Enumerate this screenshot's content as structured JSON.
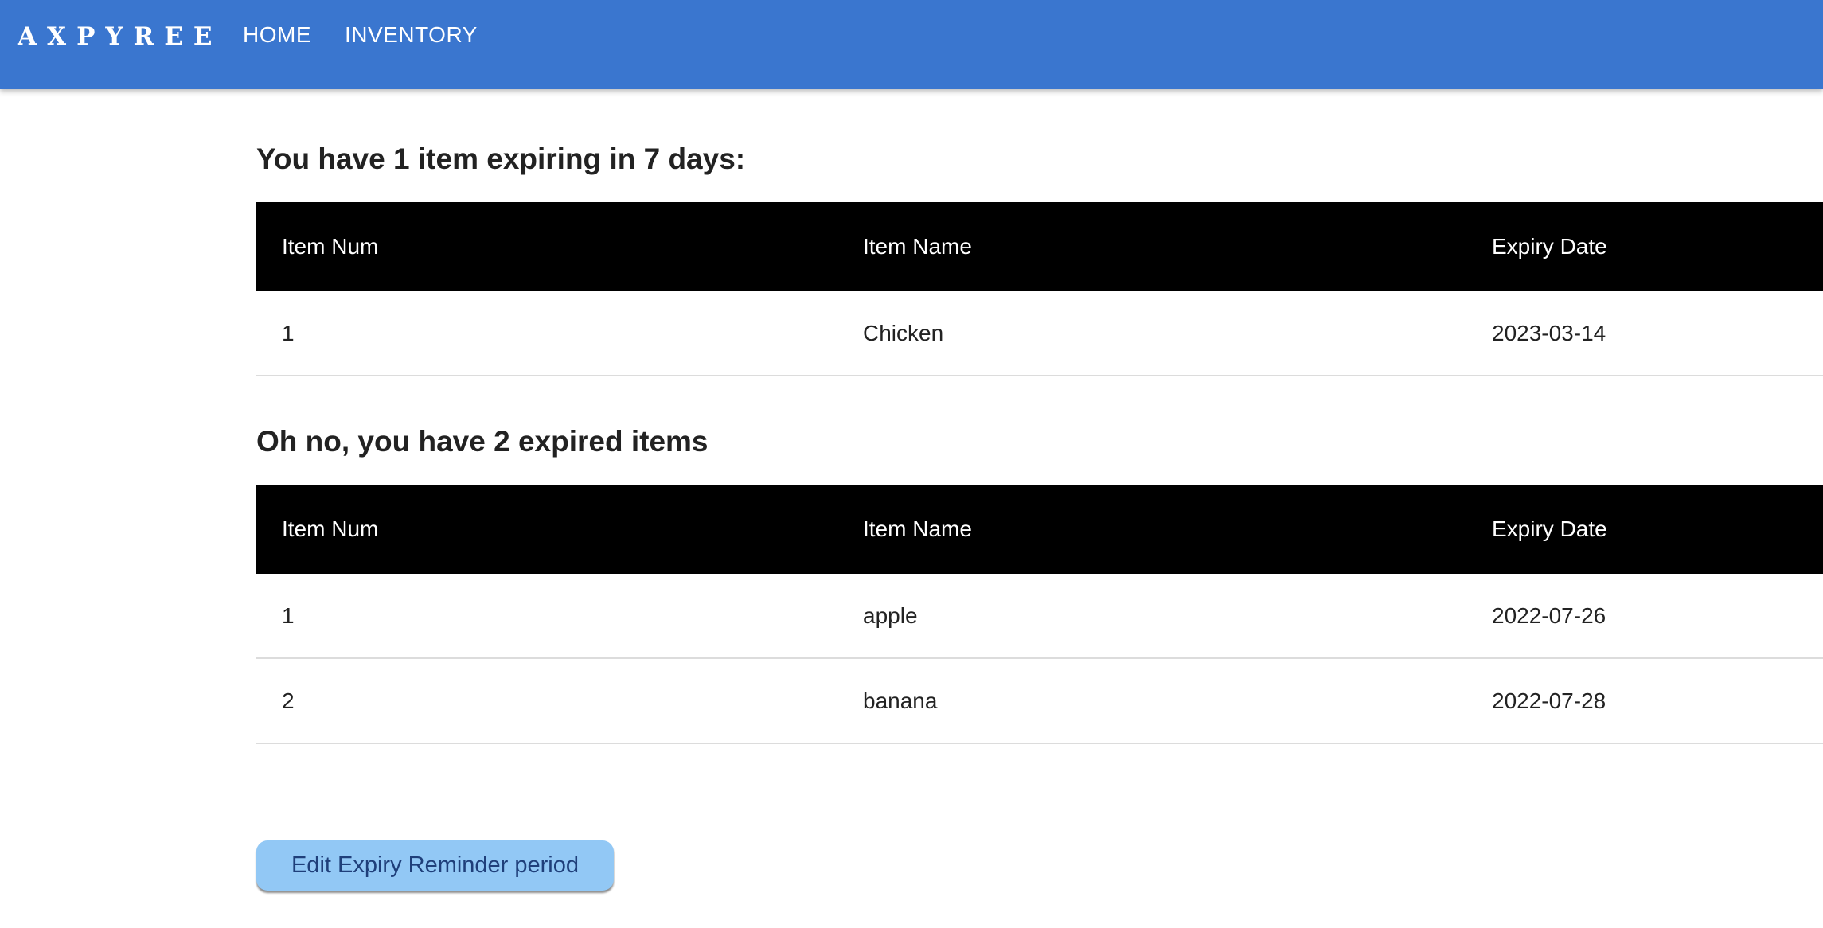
{
  "nav": {
    "brand": "AXPYREE",
    "links": [
      {
        "label": "HOME"
      },
      {
        "label": "INVENTORY"
      }
    ],
    "colors": {
      "background": "#3a76cf",
      "text": "#ffffff"
    }
  },
  "expiring": {
    "heading": "You have 1 item expiring in 7 days:",
    "columns": [
      "Item Num",
      "Item Name",
      "Expiry Date"
    ],
    "rows": [
      {
        "num": "1",
        "name": "Chicken",
        "date": "2023-03-14"
      }
    ]
  },
  "expired": {
    "heading": "Oh no, you have 2 expired items",
    "columns": [
      "Item Num",
      "Item Name",
      "Expiry Date"
    ],
    "rows": [
      {
        "num": "1",
        "name": "apple",
        "date": "2022-07-26"
      },
      {
        "num": "2",
        "name": "banana",
        "date": "2022-07-28"
      }
    ]
  },
  "actions": {
    "edit_reminder_label": "Edit Expiry Reminder period",
    "button_color": "#92c8f5"
  },
  "colors": {
    "table_header_bg": "#000000",
    "table_header_text": "#ffffff",
    "row_divider": "#dcdcdc"
  }
}
